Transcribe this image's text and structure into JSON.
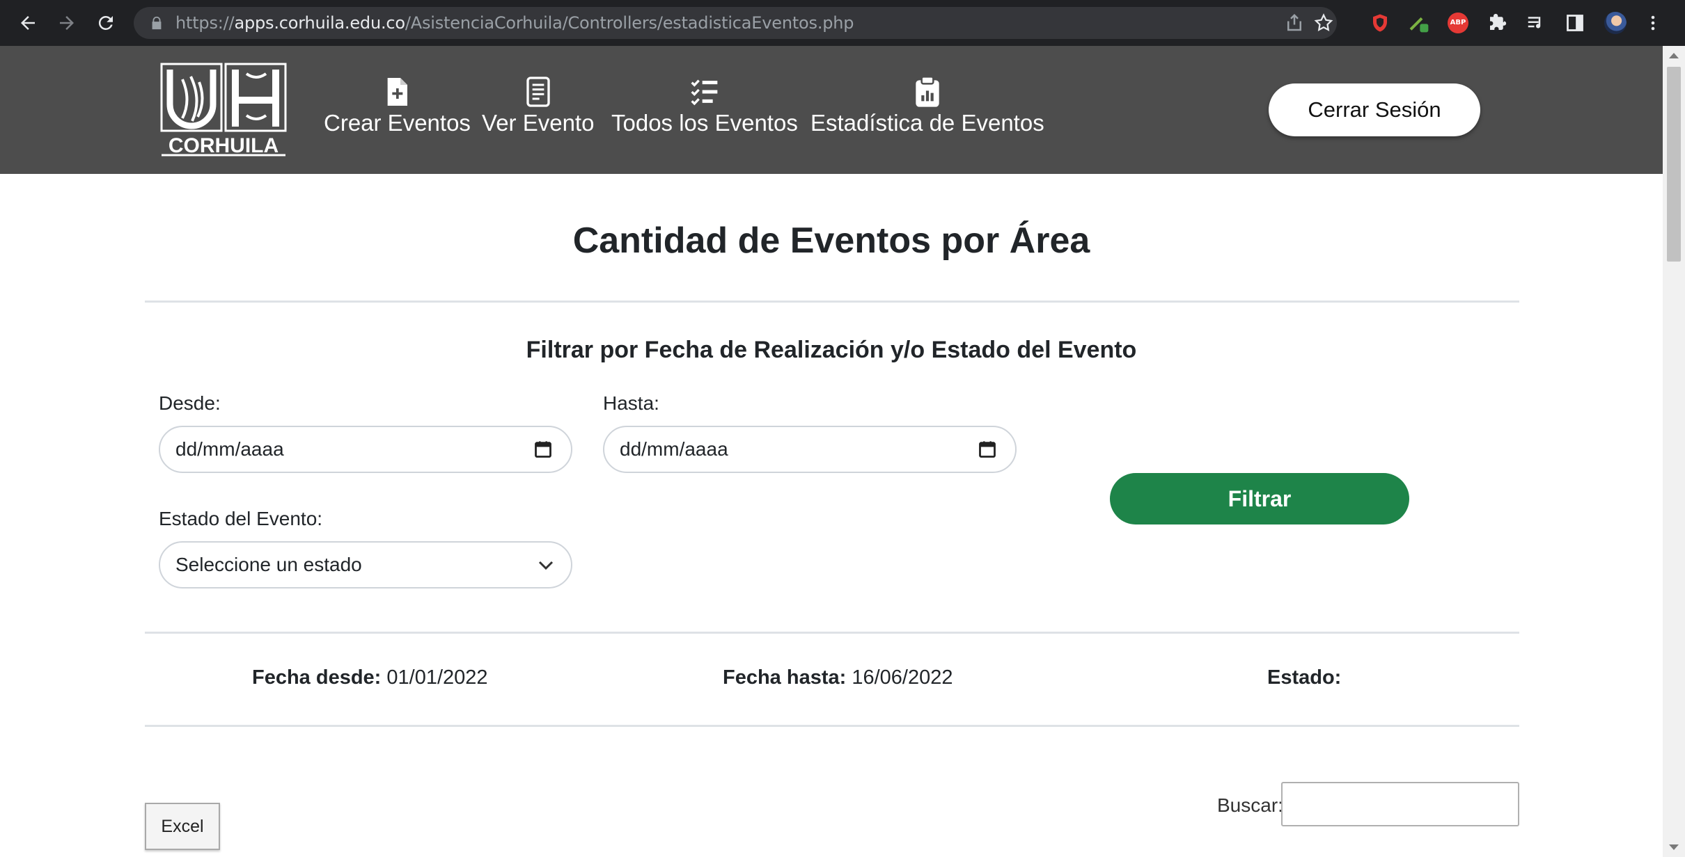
{
  "browser": {
    "url_scheme": "https://",
    "url_host": "apps.corhuila.edu.co",
    "url_path": "/AsistenciaCorhuila/Controllers/estadisticaEventos.php",
    "extensions": [
      "shield-icon",
      "pen-icon",
      "abp-icon",
      "puzzle-icon",
      "media-icon",
      "sidebar-icon",
      "avatar",
      "more-icon"
    ],
    "abp_label": "ABP"
  },
  "header": {
    "logo_text": "CORHUILA",
    "menu": [
      {
        "label": "Crear Eventos",
        "icon": "file-plus-icon"
      },
      {
        "label": "Ver Evento",
        "icon": "document-list-icon"
      },
      {
        "label": "Todos los Eventos",
        "icon": "checklist-icon"
      },
      {
        "label": "Estadística de Eventos",
        "icon": "clipboard-chart-icon"
      }
    ],
    "logout_label": "Cerrar Sesión"
  },
  "main": {
    "title": "Cantidad de Eventos por Área",
    "filter_title": "Filtrar por Fecha de Realización y/o Estado del Evento",
    "desde_label": "Desde:",
    "desde_placeholder": "dd/mm/aaaa",
    "hasta_label": "Hasta:",
    "hasta_placeholder": "dd/mm/aaaa",
    "estado_label": "Estado del Evento:",
    "estado_selected": "Seleccione un estado",
    "filter_button": "Filtrar",
    "summary": {
      "fecha_desde_label": "Fecha desde:",
      "fecha_desde_value": "01/01/2022",
      "fecha_hasta_label": "Fecha hasta:",
      "fecha_hasta_value": "16/06/2022",
      "estado_label": "Estado:",
      "estado_value": ""
    },
    "excel_button": "Excel",
    "search_label": "Buscar:",
    "search_value": ""
  },
  "colors": {
    "header_bg": "#4d4d4d",
    "filter_button_bg": "#1e8449",
    "browser_bg": "#202124"
  }
}
